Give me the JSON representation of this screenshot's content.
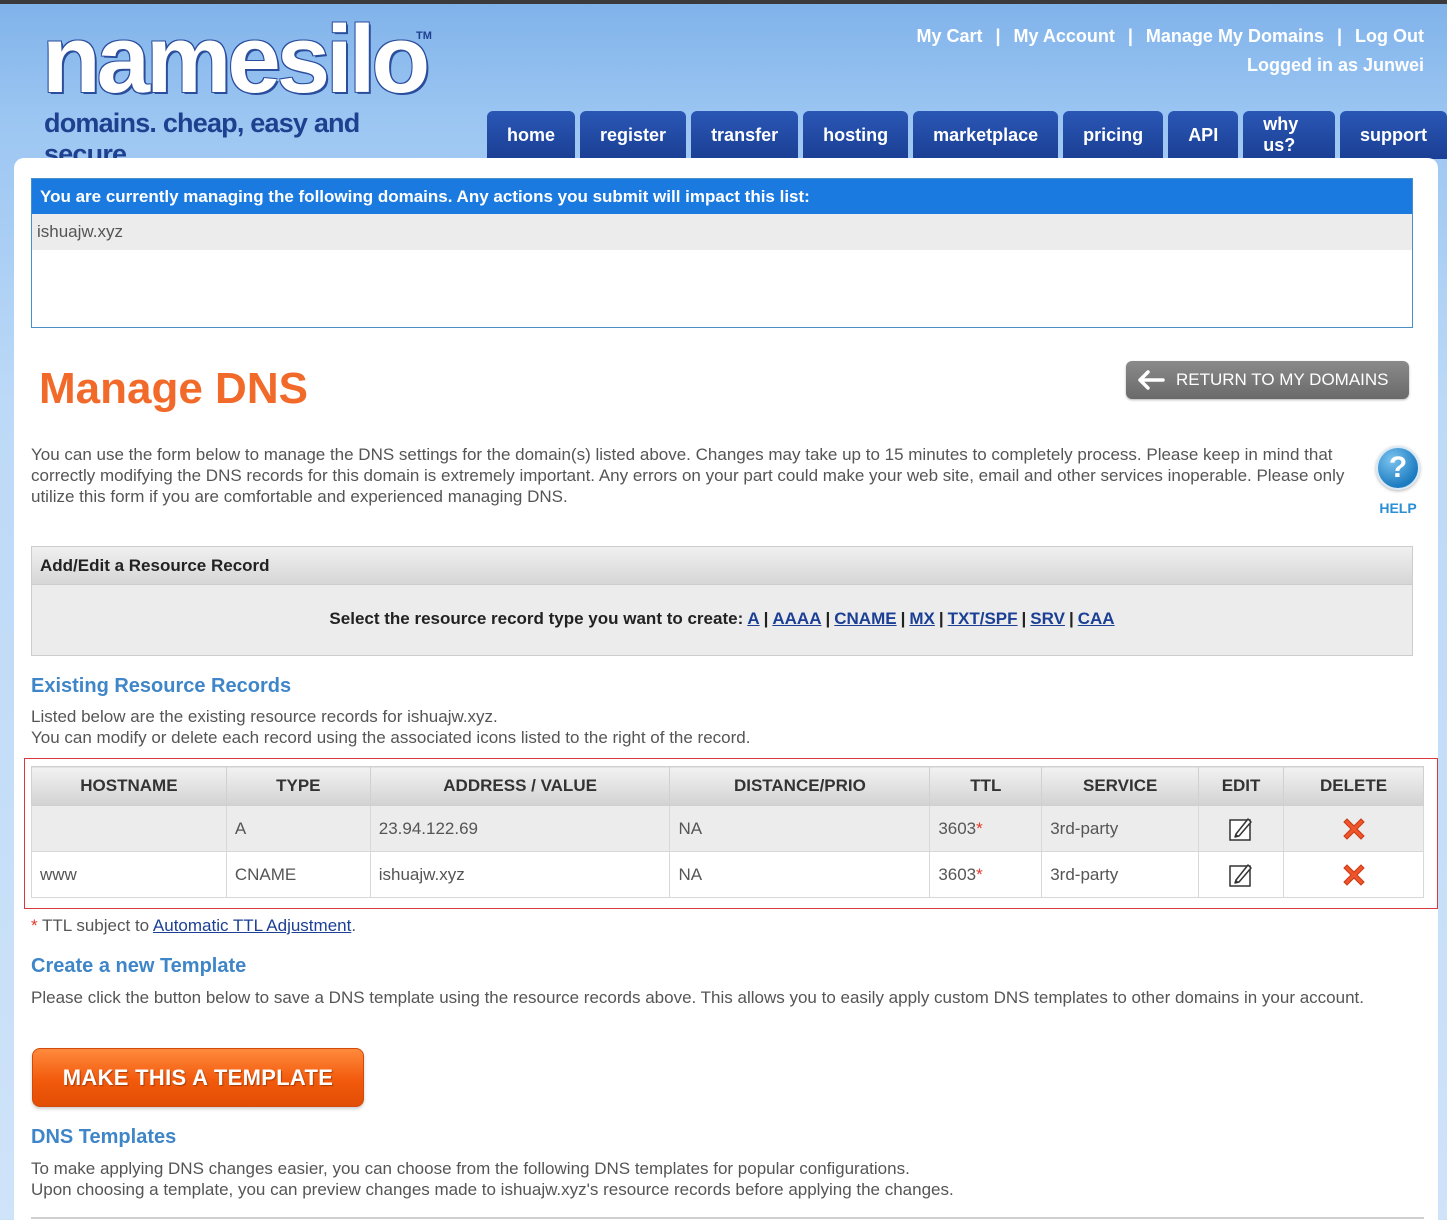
{
  "brand": {
    "word_a": "name",
    "word_b": "silo",
    "tm": "TM",
    "tagline": "domains. cheap, easy and secure."
  },
  "toplinks": {
    "cart": "My Cart",
    "account": "My Account",
    "domains": "Manage My Domains",
    "logout": "Log Out",
    "sep": "|",
    "logged_in": "Logged in as Junwei"
  },
  "nav": [
    "home",
    "register",
    "transfer",
    "hosting",
    "marketplace",
    "pricing",
    "API",
    "why us?",
    "support"
  ],
  "managing": {
    "header": "You are currently managing the following domains. Any actions you submit will impact this list:",
    "domain": "ishuajw.xyz"
  },
  "page": {
    "title": "Manage DNS",
    "return_label": "RETURN TO MY DOMAINS",
    "intro": "You can use the form below to manage the DNS settings for the domain(s) listed above. Changes may take up to 15 minutes to completely process. Please keep in mind that correctly modifying the DNS records for this domain is extremely important. Any errors on your part could make your web site, email and other services inoperable. Please only utilize this form if you are comfortable and experienced managing DNS.",
    "help_glyph": "?",
    "help_label": "HELP"
  },
  "addedit": {
    "title": "Add/Edit a Resource Record",
    "prompt": "Select the resource record type you want to create:",
    "types": [
      "A",
      "AAAA",
      "CNAME",
      "MX",
      "TXT/SPF",
      "SRV",
      "CAA"
    ],
    "sep": "|"
  },
  "existing": {
    "title": "Existing Resource Records",
    "line1": "Listed below are the existing resource records for ishuajw.xyz.",
    "line2": "You can modify or delete each record using the associated icons listed to the right of the record.",
    "columns": [
      "HOSTNAME",
      "TYPE",
      "ADDRESS / VALUE",
      "DISTANCE/PRIO",
      "TTL",
      "SERVICE",
      "EDIT",
      "DELETE"
    ],
    "rows": [
      {
        "hostname": "",
        "type": "A",
        "value": "23.94.122.69",
        "prio": "NA",
        "ttl": "3603",
        "service": "3rd-party"
      },
      {
        "hostname": "www",
        "type": "CNAME",
        "value": "ishuajw.xyz",
        "prio": "NA",
        "ttl": "3603",
        "service": "3rd-party"
      }
    ],
    "star": "*"
  },
  "ttl_note": {
    "star": "*",
    "prefix": " TTL subject to ",
    "link": "Automatic TTL Adjustment",
    "suffix": "."
  },
  "template": {
    "title": "Create a new Template",
    "text": "Please click the button below to save a DNS template using the resource records above. This allows you to easily apply custom DNS templates to other domains in your account.",
    "button": "MAKE THIS A TEMPLATE"
  },
  "dns_templates": {
    "title": "DNS Templates",
    "line1": "To make applying DNS changes easier, you can choose from the following DNS templates for popular configurations.",
    "line2": "Upon choosing a template, you can preview changes made to ishuajw.xyz's resource records before applying the changes."
  },
  "colors": {
    "accent_orange": "#f26a2a",
    "nav_blue": "#1b3f94",
    "header_blue": "#1b7ae0",
    "section_blue": "#3f86c8",
    "highlight_red": "#d9383d"
  }
}
